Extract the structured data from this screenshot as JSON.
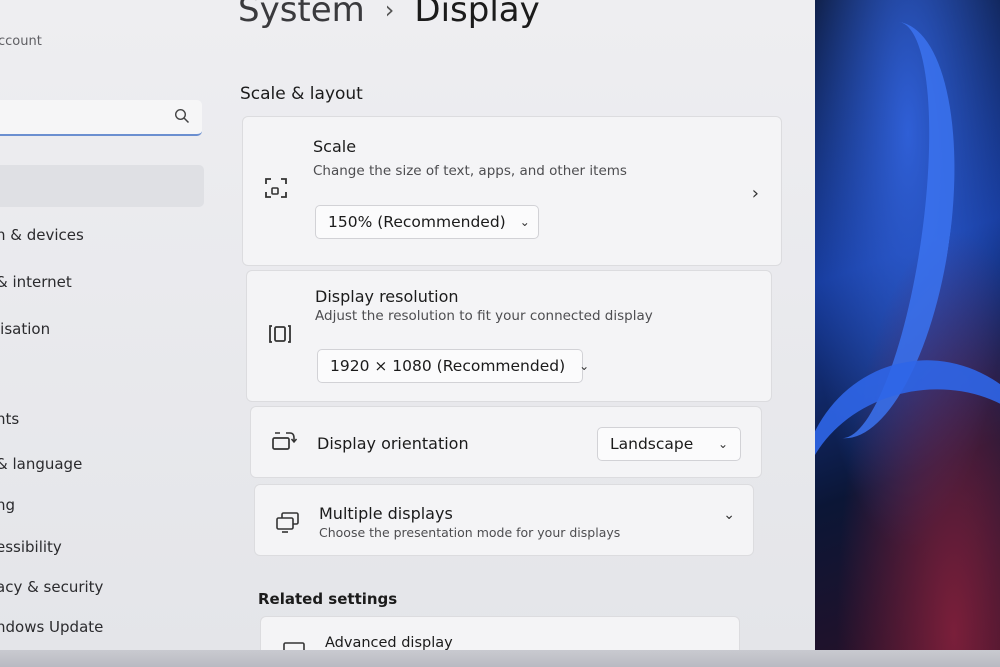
{
  "sidebar": {
    "account_text": "ccount",
    "search_placeholder": "",
    "items": [
      {
        "label": "h & devices"
      },
      {
        "label": "& internet"
      },
      {
        "label": "lisation"
      },
      {
        "label": "nts"
      },
      {
        "label": "& language"
      },
      {
        "label": "ng"
      },
      {
        "label": "essibility"
      },
      {
        "label": "acy & security"
      },
      {
        "label": "ndows Update"
      }
    ]
  },
  "header": {
    "breadcrumb_parent": "System",
    "breadcrumb_separator": "›",
    "page_title": "Display"
  },
  "sections": {
    "scale_layout_title": "Scale & layout",
    "related_settings_title": "Related settings"
  },
  "scale": {
    "title": "Scale",
    "description": "Change the size of text, apps, and other items",
    "value": "150% (Recommended)"
  },
  "resolution": {
    "title": "Display resolution",
    "description": "Adjust the resolution to fit your connected display",
    "value": "1920 × 1080 (Recommended)"
  },
  "orientation": {
    "title": "Display orientation",
    "value": "Landscape"
  },
  "multiple_displays": {
    "title": "Multiple displays",
    "description": "Choose the presentation mode for your displays"
  },
  "advanced_display": {
    "title": "Advanced display"
  },
  "colors": {
    "accent": "#6b8fd0",
    "card_bg": "#f4f4f6",
    "window_bg": "#eeeef1"
  }
}
